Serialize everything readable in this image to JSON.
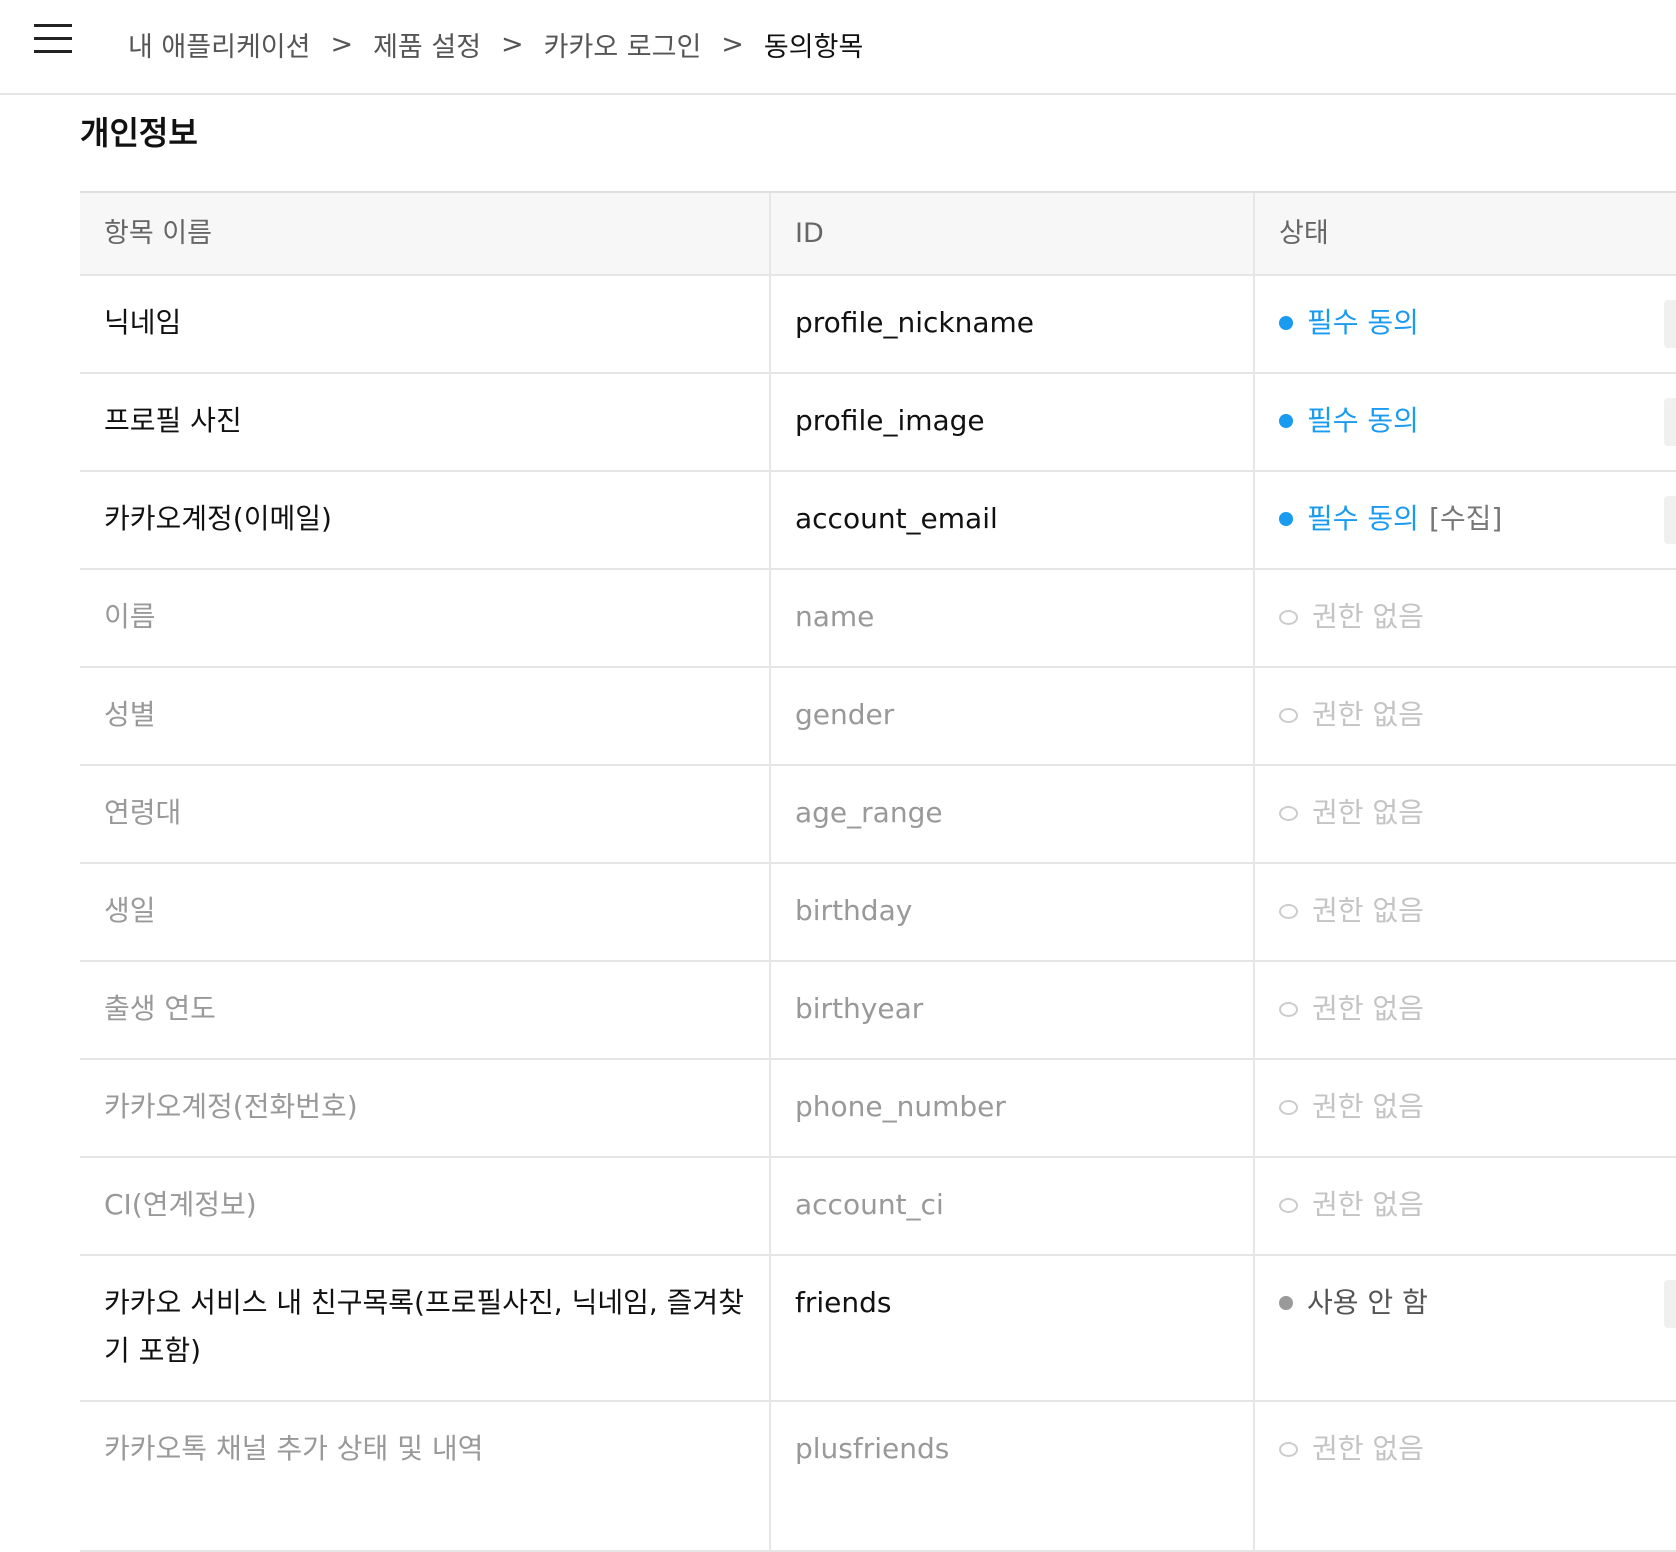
{
  "breadcrumb": {
    "items": [
      "내 애플리케이션",
      "제품 설정",
      "카카오 로그인",
      "동의항목"
    ],
    "separator": ">"
  },
  "section": {
    "title": "개인정보"
  },
  "table": {
    "headers": {
      "name": "항목 이름",
      "id": "ID",
      "status": "상태"
    },
    "rows": [
      {
        "name": "닉네임",
        "id": "profile_nickname",
        "status": "필수 동의",
        "suffix": ""
      },
      {
        "name": "프로필 사진",
        "id": "profile_image",
        "status": "필수 동의",
        "suffix": ""
      },
      {
        "name": "카카오계정(이메일)",
        "id": "account_email",
        "status": "필수 동의",
        "suffix": "[수집]"
      },
      {
        "name": "이름",
        "id": "name",
        "status": "권한 없음",
        "suffix": ""
      },
      {
        "name": "성별",
        "id": "gender",
        "status": "권한 없음",
        "suffix": ""
      },
      {
        "name": "연령대",
        "id": "age_range",
        "status": "권한 없음",
        "suffix": ""
      },
      {
        "name": "생일",
        "id": "birthday",
        "status": "권한 없음",
        "suffix": ""
      },
      {
        "name": "출생 연도",
        "id": "birthyear",
        "status": "권한 없음",
        "suffix": ""
      },
      {
        "name": "카카오계정(전화번호)",
        "id": "phone_number",
        "status": "권한 없음",
        "suffix": ""
      },
      {
        "name": "CI(연계정보)",
        "id": "account_ci",
        "status": "권한 없음",
        "suffix": ""
      },
      {
        "name": "카카오 서비스 내 친구목록(프로필사진, 닉네임, 즐겨찾기 포함)",
        "id": "friends",
        "status": "사용 안 함",
        "suffix": ""
      },
      {
        "name": "카카오톡 채널 추가 상태 및 내역",
        "id": "plusfriends",
        "status": "권한 없음",
        "suffix": ""
      }
    ]
  },
  "colors": {
    "accent_blue": "#1a9bf0",
    "muted_text": "#999999",
    "faint_status": "#c4c4c4",
    "header_bg": "#f7f7f7",
    "border": "#e6e6e6"
  }
}
